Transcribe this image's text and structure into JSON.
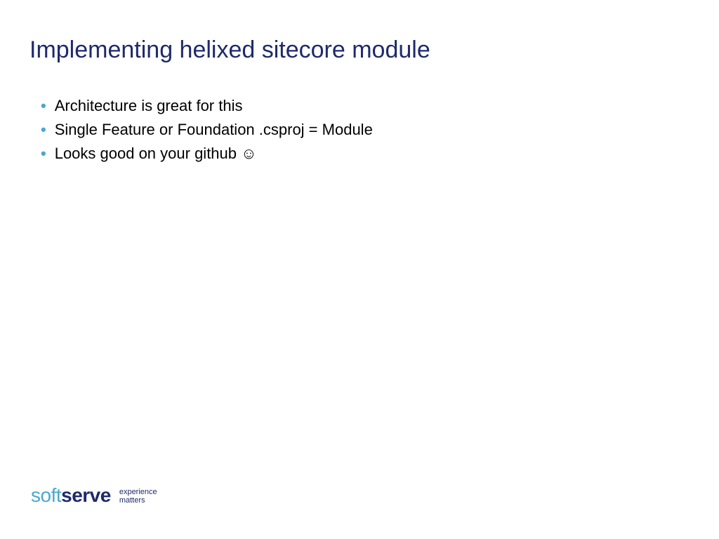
{
  "slide": {
    "title": "Implementing helixed sitecore module",
    "bullets": [
      "Architecture is great for this",
      "Single Feature or Foundation .csproj = Module",
      "Looks good on your github ☺"
    ]
  },
  "logo": {
    "part1": "soft",
    "part2": "serve",
    "tagline1": "experience",
    "tagline2": "matters"
  }
}
